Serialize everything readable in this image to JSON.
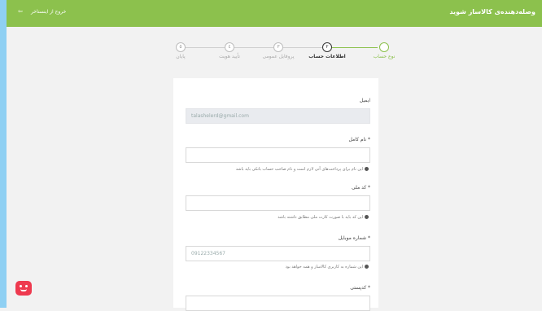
{
  "header": {
    "brand": "وصله‌دهنده‌ی کالاساز شوید",
    "logout_label": "خروج از اینستاخر",
    "logout_icon": "logout-icon"
  },
  "stepper": {
    "steps": [
      {
        "label": "نوع حساب",
        "number": "",
        "state": "done"
      },
      {
        "label": "اطلاعات حساب",
        "number": "٢",
        "state": "active"
      },
      {
        "label": "پروفایل عمومی",
        "number": "٣",
        "state": "pending"
      },
      {
        "label": "تأیید هویت",
        "number": "٤",
        "state": "pending"
      },
      {
        "label": "پایان",
        "number": "٥",
        "state": "pending"
      }
    ]
  },
  "form": {
    "email_label": "ایمیل",
    "email_value": "talashelerd@gmail.com",
    "fullname_label": "* نام کامل",
    "fullname_hint": "این نام برای پرداخت‌های آتی لازم است و نام صاحب حساب بانکی باید باشد",
    "national_code_label": "* کد ملی",
    "national_code_hint": "این کد باید با صورت کارت ملی مطابق داشته باشد",
    "mobile_label": "* شماره موبایل",
    "mobile_placeholder": "09122334567",
    "mobile_hint": "این شماره به کاربری کالاساز و همه خواهد بود",
    "landline_label": "* کدپستی"
  },
  "colors": {
    "accent": "#8cc14d",
    "chat": "#ee3a4f"
  }
}
